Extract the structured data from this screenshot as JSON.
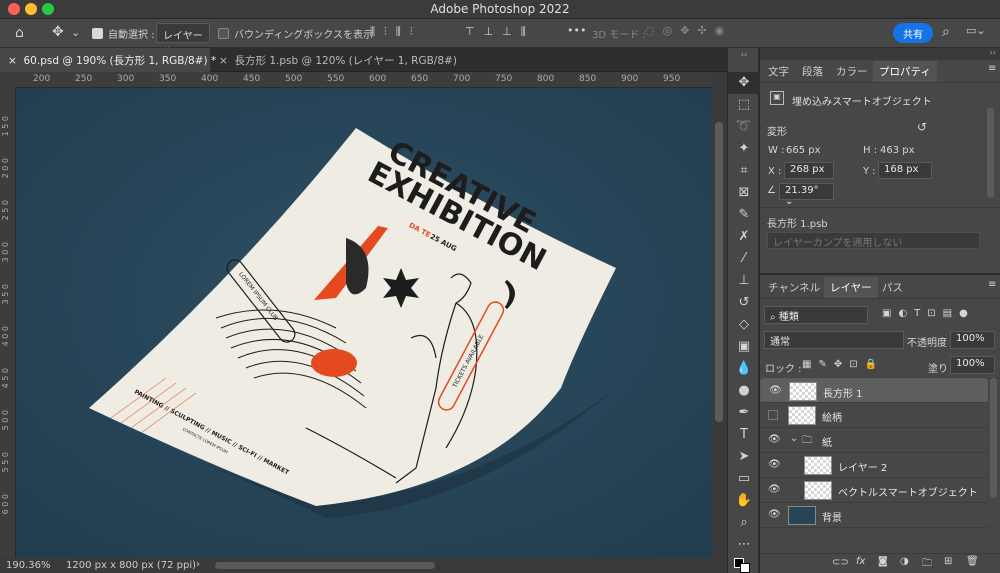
{
  "app": {
    "title": "Adobe Photoshop 2022"
  },
  "options_bar": {
    "auto_select_label": "自動選択 :",
    "auto_select_value": "レイヤー",
    "bounding_box_label": "バウンディングボックスを表示",
    "mode_3d_label": "3D モード :",
    "share_label": "共有"
  },
  "tabs": [
    {
      "label": "60.psd @ 190% (長方形 1, RGB/8#) *"
    },
    {
      "label": "長方形 1.psb @ 120% (レイヤー 1, RGB/8#)"
    }
  ],
  "ruler_h": [
    "200",
    "250",
    "300",
    "350",
    "400",
    "450",
    "500",
    "550",
    "600",
    "650",
    "700",
    "750",
    "800",
    "850",
    "900",
    "950",
    "1000"
  ],
  "ruler_v": [
    "1 0 0",
    "1 5 0",
    "2 0 0",
    "2 5 0",
    "3 0 0",
    "3 5 0",
    "4 0 0",
    "4 5 0",
    "5 0 0",
    "5 5 0",
    "6 0 0",
    "6 5 0",
    "7 0 0"
  ],
  "poster": {
    "title_line1": "CREATIVE",
    "title_line2": "EXHIBITION",
    "tickets": "TICKETS AVAILABLE",
    "lorem": "LOREM IPSUM CLUB",
    "bottom_line": "PAINTING // SCULPTING // MUSIC // SCI-FI // MARKET",
    "contact": "CONTACTE LOREM IPSUM",
    "date_a": "DA TE",
    "date_b": "25 AUG"
  },
  "status": {
    "zoom": "190.36%",
    "doc_size": "1200 px x 800 px (72 ppi)"
  },
  "properties_panel": {
    "tabs": [
      "文字",
      "段落",
      "カラー",
      "プロパティ"
    ],
    "object_type": "埋め込みスマートオブジェクト",
    "transform_label": "変形",
    "w_label": "W :",
    "w_value": "665 px",
    "h_label": "H :",
    "h_value": "463 px",
    "x_label": "X :",
    "x_value": "268 px",
    "y_label": "Y :",
    "y_value": "168 px",
    "angle_value": "21.39°",
    "linked_file": "長方形 1.psb",
    "layer_comp_placeholder": "レイヤーカンプを適用しない"
  },
  "layers_panel": {
    "tabs": [
      "チャンネル",
      "レイヤー",
      "パス"
    ],
    "filter_kind": "種類",
    "blend_mode": "通常",
    "opacity_label": "不透明度 :",
    "opacity_value": "100%",
    "lock_label": "ロック :",
    "fill_label": "塗り :",
    "fill_value": "100%",
    "layers": [
      {
        "name": "長方形 1",
        "visible": true,
        "selected": true
      },
      {
        "name": "絵柄",
        "visible": false,
        "selected": false
      },
      {
        "name": "紙",
        "visible": true,
        "selected": false
      },
      {
        "name": "レイヤー 2",
        "visible": true,
        "selected": false
      },
      {
        "name": "ベクトルスマートオブジェクト",
        "visible": true,
        "selected": false
      },
      {
        "name": "背景",
        "visible": true,
        "selected": false
      }
    ]
  },
  "colors": {
    "canvas": "#284558",
    "accent": "#1473e6",
    "poster_red": "#e4491f",
    "paper": "#efece3"
  }
}
